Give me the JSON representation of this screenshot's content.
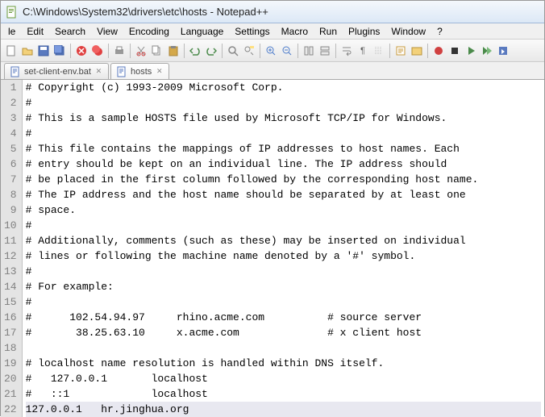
{
  "window": {
    "title": "C:\\Windows\\System32\\drivers\\etc\\hosts - Notepad++"
  },
  "menu": {
    "items": [
      "le",
      "Edit",
      "Search",
      "View",
      "Encoding",
      "Language",
      "Settings",
      "Macro",
      "Run",
      "Plugins",
      "Window",
      "?"
    ]
  },
  "tabs": [
    {
      "label": "set-client-env.bat",
      "active": false
    },
    {
      "label": "hosts",
      "active": true
    }
  ],
  "lines": [
    "# Copyright (c) 1993-2009 Microsoft Corp.",
    "#",
    "# This is a sample HOSTS file used by Microsoft TCP/IP for Windows.",
    "#",
    "# This file contains the mappings of IP addresses to host names. Each",
    "# entry should be kept on an individual line. The IP address should",
    "# be placed in the first column followed by the corresponding host name.",
    "# The IP address and the host name should be separated by at least one",
    "# space.",
    "#",
    "# Additionally, comments (such as these) may be inserted on individual",
    "# lines or following the machine name denoted by a '#' symbol.",
    "#",
    "# For example:",
    "#",
    "#      102.54.94.97     rhino.acme.com          # source server",
    "#       38.25.63.10     x.acme.com              # x client host",
    "",
    "# localhost name resolution is handled within DNS itself.",
    "#   127.0.0.1       localhost",
    "#   ::1             localhost",
    "127.0.0.1   hr.jinghua.org"
  ],
  "highlight_line": 22
}
